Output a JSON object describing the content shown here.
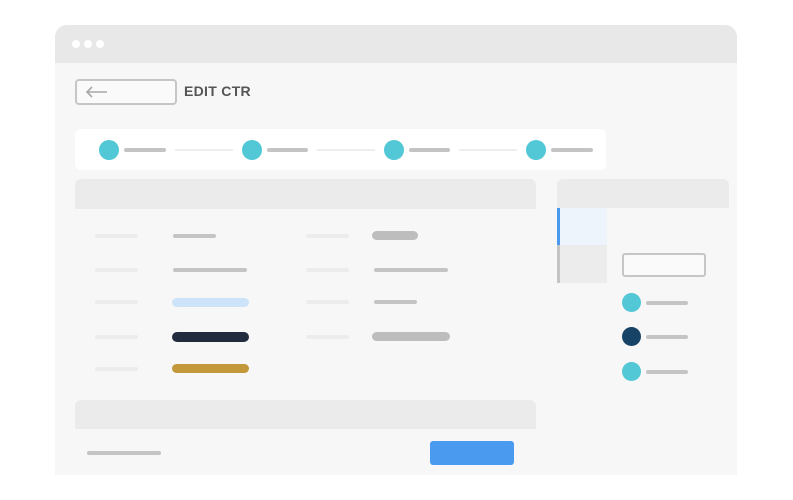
{
  "window": {
    "title_bar_dots": [
      "dot",
      "dot",
      "dot"
    ]
  },
  "header": {
    "back_icon": "arrow-left-icon",
    "title": "EDIT CTR"
  },
  "stepper": {
    "accent_color": "#52c7d6",
    "steps": [
      "",
      "",
      "",
      ""
    ]
  },
  "table": {
    "row_count": 5,
    "value_colors": {
      "row3": "#cde3fa",
      "row4": "#202b3d",
      "row5": "#c2983a"
    }
  },
  "footer": {
    "primary_button_color": "#4a9af0"
  },
  "side_panel": {
    "active_tab_color": "#4a9af0",
    "legend_colors": [
      "#52c7d6",
      "#174366",
      "#52c7d6"
    ]
  }
}
